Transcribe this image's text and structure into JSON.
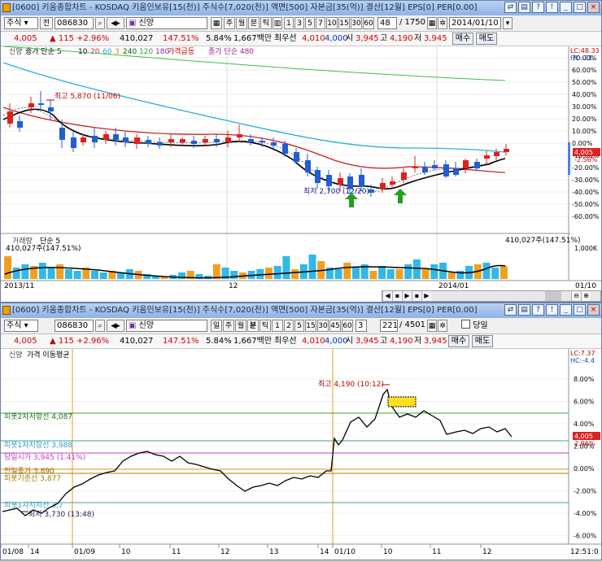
{
  "window1": {
    "title": "[0600] 키움종합차트 - KOSDAQ 키움인보유[15(천)] 주식수[7,020(천)] 액면[500] 자본금[35(억)] 결산[12월] EPS[0] PER[0.00]",
    "toolbar": {
      "market": "주식",
      "market_btn": "전",
      "code": "086830",
      "stock_name": "신양",
      "period_buttons": [
        "주",
        "월",
        "분",
        "틱"
      ],
      "interval_buttons": [
        "1",
        "3",
        "5",
        "7",
        "10",
        "15",
        "30",
        "60"
      ],
      "count": "48",
      "count_total": "/ 1750",
      "date": "2014/01/10"
    },
    "quote": {
      "price": "4,005",
      "change": "▲ 115",
      "change_pct": "+2.96%",
      "volume": "410,027",
      "volume_pct": "147.51%",
      "turnover": "5.84%",
      "amount": "1,667백만",
      "best_label": "최우선",
      "best_ask": "4,010",
      "best_bid": "4,000",
      "open_label": "시",
      "open": "3,945",
      "high_label": "고",
      "high": "4,190",
      "low_label": "저",
      "low": "3,945",
      "buy_label": "매수",
      "sell_label": "매도"
    },
    "legend": {
      "name": "신양",
      "ma_label": "종가 단순 5",
      "ma_periods": [
        "10",
        "20",
        "60",
        "3",
        "240",
        "120",
        "180"
      ],
      "price_rise": "가격급등",
      "ma480": "종가 단순 480"
    },
    "right_labels": {
      "lc": "LC:48.33",
      "hc": "HC:-31.",
      "price_tag": "4,005",
      "pct_tag": "-2.56%"
    },
    "y_ticks": [
      "70.00%",
      "60.00%",
      "50.00%",
      "40.00%",
      "30.00%",
      "20.00%",
      "10.00%",
      "0.00%",
      "-10.00%",
      "-20.00%",
      "-30.00%",
      "-40.00%",
      "-50.00%",
      "-60.00%"
    ],
    "annotations": {
      "high": "최고 5,870 (11/06)",
      "low": "최저 2,700 (12/20)"
    },
    "volume_panel": {
      "label": "거래량",
      "ma": "단순 5",
      "left_value": "410,027주(147.51%)",
      "right_value": "410,027주(147.51%)",
      "axis": "1,000K"
    },
    "x_labels": [
      "2013/11",
      "12",
      "2014/01",
      "01/10"
    ]
  },
  "window2": {
    "title": "[0600] 키움종합차트 - KOSDAQ 키움인보유[15(천)] 주식수[7,020(천)] 액면[500] 자본금[35(억)] 결산[12월] EPS[0] PER[0.00]",
    "toolbar": {
      "market": "주식",
      "code": "086830",
      "stock_name": "신양",
      "period_buttons": [
        "일",
        "주",
        "월",
        "분",
        "틱"
      ],
      "interval_buttons": [
        "1",
        "2",
        "5",
        "15",
        "30",
        "45",
        "60",
        "3"
      ],
      "count": "221",
      "count_total": "/ 4501",
      "same_day": "당일"
    },
    "quote": {
      "price": "4,005",
      "change": "▲ 115",
      "change_pct": "+2.96%",
      "volume": "410,027",
      "volume_pct": "147.51%",
      "turnover": "5.84%",
      "amount": "1,667백만",
      "best_label": "최우선",
      "best_ask": "4,010",
      "best_bid": "4,000",
      "open_label": "시",
      "open": "3,945",
      "high_label": "고",
      "high": "4,190",
      "low_label": "저",
      "low": "3,945",
      "buy_label": "매수",
      "sell_label": "매도"
    },
    "legend": {
      "name": "신양",
      "ma": "가격 이동평균"
    },
    "right_labels": {
      "lc": "LC:7.37",
      "hc": "HC:-4.4",
      "price_tag": "4,005",
      "pct_tag": "2.96%"
    },
    "y_ticks": [
      "8.00%",
      "6.00%",
      "4.00%",
      "2.00%",
      "0.00%",
      "-2.00%",
      "-4.00%",
      "-6.00%"
    ],
    "levels": {
      "pivot2_resist": "피봇2차저항선 4,087",
      "pivot1_resist": "피봇1차저항선 3,988",
      "today_open": "당일시가 3,945 (1.41%)",
      "prev_close": "전일종가 3,890",
      "pivot_base": "피봇기준선 3,877",
      "pivot1_support": "피봇1차지지선 3,7",
      "low": "최저 3,730 (13:48)",
      "high": "최고 4,190 (10:12)"
    },
    "x_labels": [
      "01/08",
      "14",
      "01/09",
      "10",
      "11",
      "12",
      "13",
      "14",
      "01/10",
      "10",
      "11",
      "12"
    ],
    "time_label": "12:51:0"
  },
  "colors": {
    "rise": "#e02020",
    "fall": "#1f5fd0",
    "ma5": "#000000",
    "ma20": "#cc2020",
    "ma60": "#28b0d8",
    "ma120": "#3cc040",
    "vol_up": "#f0a020",
    "vol_dn": "#30b8e8"
  },
  "chart_data": [
    {
      "type": "line",
      "title": "",
      "xlabel": "",
      "ylabel": "",
      "x": [
        "2013/11",
        "12",
        "2014/01",
        "01/10"
      ],
      "series": [
        {
          "name": "종가 단순 5",
          "values": []
        }
      ],
      "ylim": [
        -60,
        70
      ],
      "grid": true,
      "legend": "top-left"
    },
    {
      "type": "line",
      "title": "",
      "xlabel": "",
      "ylabel": "",
      "x": [
        "01/08",
        "01/09",
        "01/10"
      ],
      "series": [
        {
          "name": "가격 이동평균",
          "values": []
        }
      ],
      "ylim": [
        -6,
        8
      ],
      "grid": true,
      "legend": "top-left"
    }
  ]
}
